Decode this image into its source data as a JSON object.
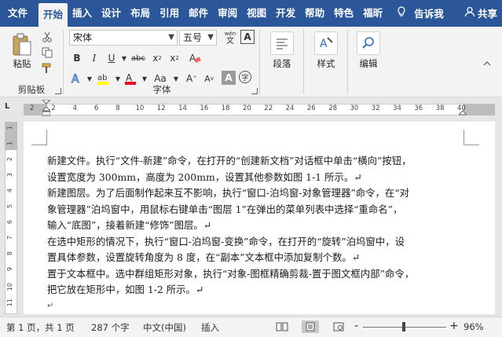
{
  "tabs": [
    {
      "label": "文件"
    },
    {
      "label": "开始"
    },
    {
      "label": "插入"
    },
    {
      "label": "设计"
    },
    {
      "label": "布局"
    },
    {
      "label": "引用"
    },
    {
      "label": "邮件"
    },
    {
      "label": "审阅"
    },
    {
      "label": "视图"
    },
    {
      "label": "开发"
    },
    {
      "label": "帮助"
    },
    {
      "label": "特色"
    },
    {
      "label": "福昕"
    }
  ],
  "tell_me": "告诉我",
  "share": "共享",
  "ribbon": {
    "clipboard": {
      "paste": "粘贴",
      "label": "剪贴板"
    },
    "font": {
      "name": "宋体",
      "size": "五号",
      "label": "字体",
      "wen": "wén",
      "wen_char": "文"
    },
    "paragraph": {
      "label": "段落"
    },
    "styles": {
      "label": "样式"
    },
    "editing": {
      "label": "编辑"
    }
  },
  "ruler": {
    "ticks": [
      "2",
      "2",
      "4",
      "6",
      "8",
      "10",
      "12",
      "14",
      "16",
      "18",
      "20",
      "22",
      "24",
      "26",
      "28",
      "30",
      "32",
      "34",
      "36",
      "38",
      "40"
    ],
    "tab_selector": "L"
  },
  "vruler": {
    "ticks": [
      "1",
      "1",
      "2",
      "3",
      "4",
      "5",
      "6",
      "7",
      "8",
      "9",
      "10",
      "11"
    ]
  },
  "document": {
    "lines": [
      "新建文件。执行“文件-新建”命令，在打开的“创建新文档”对话框中单击“横向”按钮，",
      "设置宽度为 300mm，高度为 200mm，设置其他参数如图 1-1 所示。↵",
      "新建图层。为了后面制作起来互不影响，执行“窗口-泊坞窗-对象管理器”命令，在“对",
      "象管理器”泊坞窗中，用鼠标右键单击“图层 1”在弹出的菜单列表中选择“重命名”，",
      "输入“底图”，接着新建“修饰”图层。↵",
      "在选中矩形的情况下，执行“窗口-泊坞窗-变换”命令，在打开的“旋转”泊坞窗中，设",
      "置具体参数，设置旋转角度为 8 度，在“副本”文本框中添加复制个数。↵",
      "置于文本框中。选中群组矩形对象，执行“对象-图框精确剪裁-置于图文框内部”命令，",
      "把它放在矩形中，如图 1-2 所示。↵",
      "↵"
    ]
  },
  "status": {
    "page": "第 1 页，共 1 页",
    "words": "287 个字",
    "language": "中文(中国)",
    "mode": "插入",
    "zoom": "96%",
    "zoom_minus": "-",
    "zoom_plus": "+"
  },
  "colors": {
    "title_bar": "#2b579a",
    "ribbon_bg": "#f3f3f3",
    "highlight_yellow": "#ffff00",
    "font_red": "#e81123"
  }
}
